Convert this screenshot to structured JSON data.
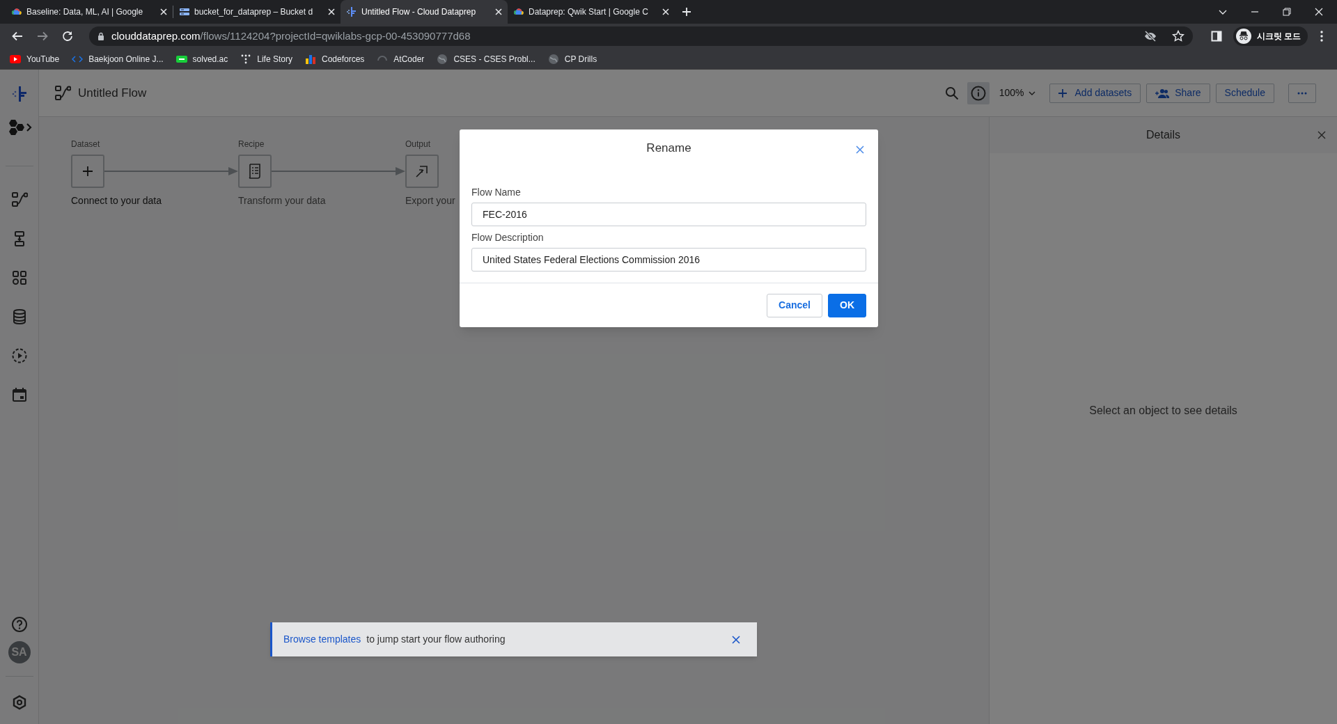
{
  "browser": {
    "tabs": [
      {
        "title": "Baseline: Data, ML, AI | Google",
        "selected": false
      },
      {
        "title": "bucket_for_dataprep – Bucket d",
        "selected": false
      },
      {
        "title": "Untitled Flow - Cloud Dataprep",
        "selected": true
      },
      {
        "title": "Dataprep: Qwik Start | Google C",
        "selected": false
      }
    ],
    "url": {
      "host": "clouddataprep.com",
      "path": "/flows/1124204?projectId=qwiklabs-gcp-00-453090777d68"
    },
    "bookmarks": [
      {
        "label": "YouTube"
      },
      {
        "label": "Baekjoon Online J..."
      },
      {
        "label": "solved.ac"
      },
      {
        "label": "Life Story"
      },
      {
        "label": "Codeforces"
      },
      {
        "label": "AtCoder"
      },
      {
        "label": "CSES - CSES Probl..."
      },
      {
        "label": "CP Drills"
      }
    ],
    "profile": "시크릿 모드"
  },
  "app": {
    "title": "Untitled Flow",
    "zoom": "100%",
    "buttons": [
      {
        "label": "Add datasets"
      },
      {
        "label": "Share"
      },
      {
        "label": "Schedule"
      }
    ],
    "avatar": "SA",
    "steps": [
      {
        "label": "Dataset",
        "caption": "Connect to your data"
      },
      {
        "label": "Recipe",
        "caption": "Transform your data"
      },
      {
        "label": "Output",
        "caption": "Export your"
      }
    ],
    "details": {
      "title": "Details",
      "empty": "Select an object to see details"
    },
    "toast": {
      "link": "Browse templates",
      "text": "to jump start your flow authoring"
    }
  },
  "dialog": {
    "title": "Rename",
    "fields": [
      {
        "label": "Flow Name",
        "value": "FEC-2016"
      },
      {
        "label": "Flow Description",
        "value": "United States Federal Elections Commission 2016"
      }
    ],
    "buttons": [
      {
        "label": "Cancel",
        "kind": "secondary"
      },
      {
        "label": "OK",
        "kind": "primary"
      }
    ]
  }
}
